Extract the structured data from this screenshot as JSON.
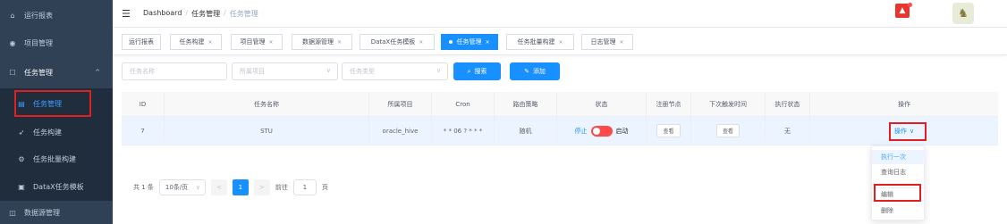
{
  "sidebar": {
    "items": [
      {
        "icon": "dashboard-icon",
        "glyph": "⌂",
        "label": "运行报表"
      },
      {
        "icon": "project-icon",
        "glyph": "◉",
        "label": "项目管理"
      },
      {
        "icon": "task-icon",
        "glyph": "☐",
        "label": "任务管理",
        "arrow": "^"
      },
      {
        "icon": "list-icon",
        "glyph": "▤",
        "label": "任务管理"
      },
      {
        "icon": "send-icon",
        "glyph": "➶",
        "label": "任务构建"
      },
      {
        "icon": "gear-icon",
        "glyph": "⚙",
        "label": "任务批量构建"
      },
      {
        "icon": "template-icon",
        "glyph": "▣",
        "label": "DataX任务模板"
      },
      {
        "icon": "database-icon",
        "glyph": "◫",
        "label": "数据源管理"
      }
    ]
  },
  "header": {
    "menu_glyph": "☰",
    "breadcrumb": [
      "Dashboard",
      "任务管理",
      "任务管理"
    ],
    "sep": "/",
    "bell_glyph": "▲",
    "avatar_glyph": "♞"
  },
  "tags": [
    {
      "label": "运行报表",
      "close": ""
    },
    {
      "label": "任务构建",
      "close": "×"
    },
    {
      "label": "项目管理",
      "close": "×"
    },
    {
      "label": "数据源管理",
      "close": "×"
    },
    {
      "label": "DataX任务模板",
      "close": "×"
    },
    {
      "label": "任务管理",
      "close": "×"
    },
    {
      "label": "任务批量构建",
      "close": "×"
    },
    {
      "label": "日志管理",
      "close": "×"
    }
  ],
  "search": {
    "task_name_placeholder": "任务名称",
    "project_placeholder": "所属项目",
    "task_type_placeholder": "任务类型",
    "chev": "∨",
    "search_label": "搜索",
    "search_glyph": "⌕",
    "add_label": "添加",
    "add_glyph": "✎"
  },
  "table": {
    "columns": [
      "ID",
      "任务名称",
      "所属项目",
      "Cron",
      "路由策略",
      "状态",
      "注册节点",
      "下次触发时间",
      "执行状态",
      "操作"
    ],
    "row": {
      "id": "7",
      "name": "STU",
      "project": "oracle_hive",
      "cron": "* * 06 ? * * *",
      "route": "随机",
      "status_stop": "停止",
      "status_start": "启动",
      "view": "查看",
      "next_view": "查看",
      "exec_status": "无",
      "ops": "操作",
      "ops_chev": "∨"
    }
  },
  "pagination": {
    "total": "共 1 条",
    "page_size": "10条/页",
    "chev": "∨",
    "prev": "<",
    "current": "1",
    "next": ">",
    "goto": "前往",
    "goto_value": "1",
    "page_unit": "页"
  },
  "dropdown": {
    "items": [
      "执行一次",
      "查询日志",
      "编辑",
      "删除"
    ]
  },
  "colors": {
    "sidebar_bg": "#304156",
    "primary": "#1890ff",
    "highlight_box": "#e02020",
    "switch_off": "#ff4949"
  }
}
